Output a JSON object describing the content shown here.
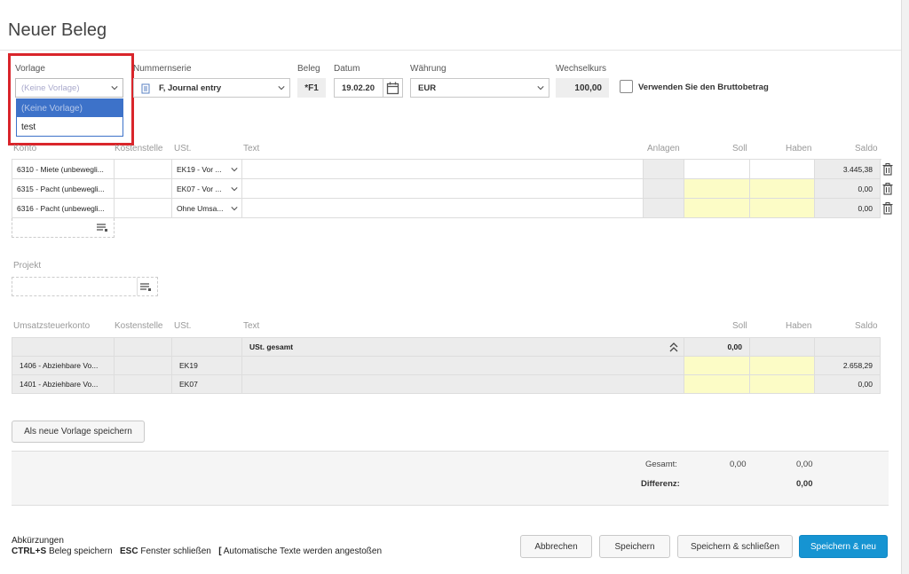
{
  "title": "Neuer Beleg",
  "header": {
    "vorlage_label": "Vorlage",
    "vorlage_value": "(Keine Vorlage)",
    "vorlage_options": [
      "(Keine Vorlage)",
      "test"
    ],
    "nummernserie_label": "Nummernserie",
    "nummernserie_value": "F, Journal entry",
    "beleg_label": "Beleg",
    "beleg_value": "*F1",
    "datum_label": "Datum",
    "datum_value": "19.02.20",
    "waehrung_label": "Währung",
    "waehrung_value": "EUR",
    "wechselkurs_label": "Wechselkurs",
    "wechselkurs_value": "100,00",
    "brutto_label": "Verwenden Sie den Bruttobetrag"
  },
  "lines_table": {
    "columns": [
      "Konto",
      "Kostenstelle",
      "USt.",
      "Text",
      "Anlagen",
      "Soll",
      "Haben",
      "Saldo"
    ],
    "rows": [
      {
        "konto": "6310 - Miete (unbewegli...",
        "ust": "EK19 - Vor ...",
        "saldo": "3.445,38"
      },
      {
        "konto": "6315 - Pacht (unbewegli...",
        "ust": "EK07 - Vor ...",
        "saldo": "0,00"
      },
      {
        "konto": "6316 - Pacht (unbewegli...",
        "ust": "Ohne Umsa...",
        "saldo": "0,00"
      }
    ]
  },
  "projekt_label": "Projekt",
  "tax_table": {
    "columns": [
      "Umsatzsteuerkonto",
      "Kostenstelle",
      "USt.",
      "Text",
      "Soll",
      "Haben",
      "Saldo"
    ],
    "summary_text": "USt. gesamt",
    "summary_soll": "0,00",
    "rows": [
      {
        "konto": "1406 - Abziehbare Vo...",
        "ust": "EK19",
        "saldo": "2.658,29"
      },
      {
        "konto": "1401 - Abziehbare Vo...",
        "ust": "EK07",
        "saldo": "0,00"
      }
    ]
  },
  "save_template_label": "Als neue Vorlage speichern",
  "totals": {
    "gesamt_label": "Gesamt:",
    "gesamt_soll": "0,00",
    "gesamt_haben": "0,00",
    "differenz_label": "Differenz:",
    "differenz_value": "0,00"
  },
  "footer": {
    "abk_label": "Abkürzungen",
    "sc1_key": "CTRL+S",
    "sc1_text": "Beleg speichern",
    "sc2_key": "ESC",
    "sc2_text": "Fenster schließen",
    "sc3_key": "[",
    "sc3_text": "Automatische Texte werden angestoßen"
  },
  "buttons": {
    "abbrechen": "Abbrechen",
    "speichern": "Speichern",
    "speichern_schliessen": "Speichern & schließen",
    "speichern_neu": "Speichern & neu"
  },
  "colors": {
    "primary": "#1694d2",
    "highlight_red": "#d9252b",
    "yellow_cell": "#fcfcc6",
    "dropdown_selected": "#3d72c9"
  }
}
